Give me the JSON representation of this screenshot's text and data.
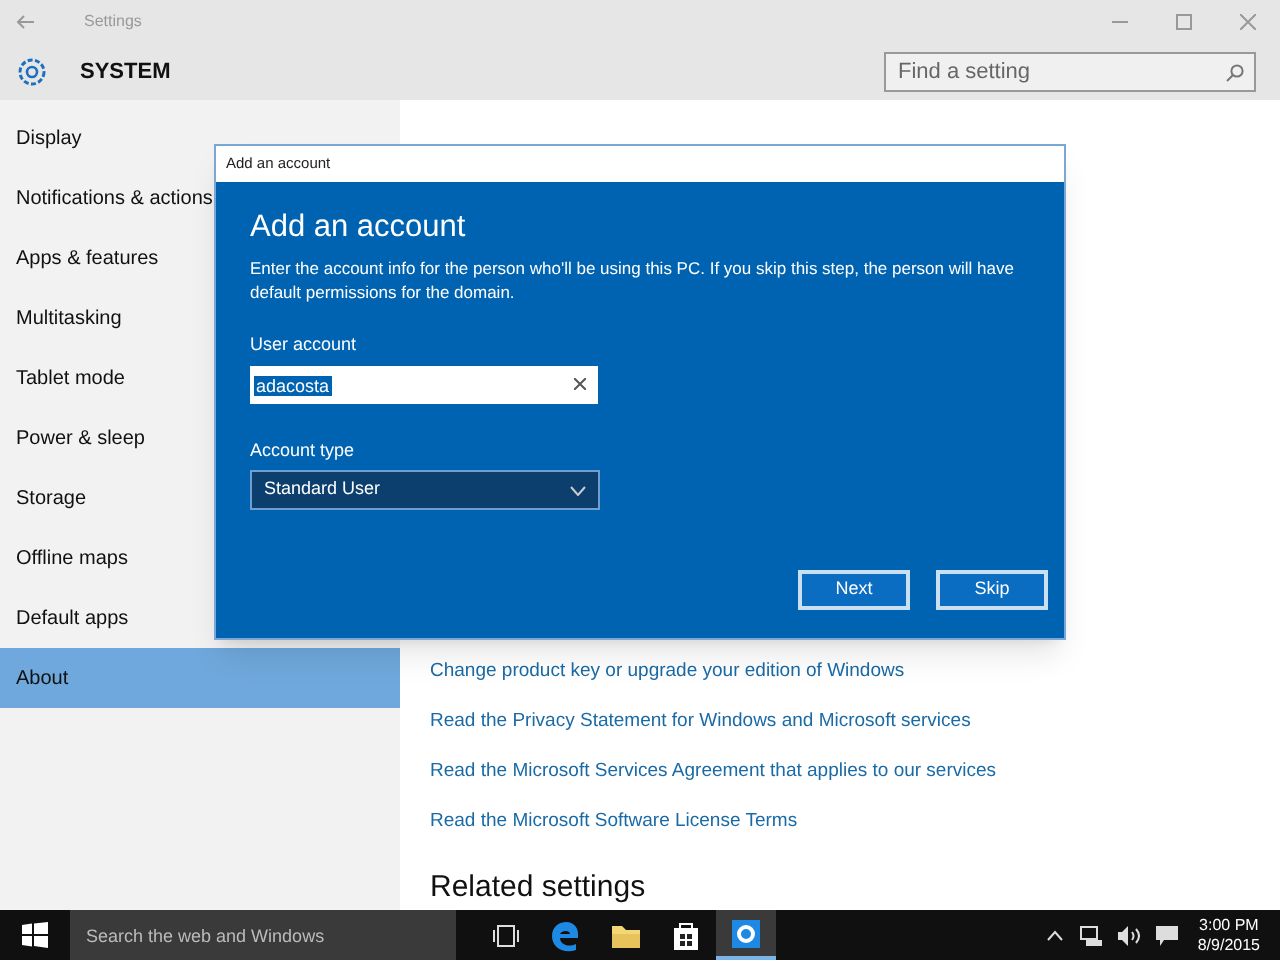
{
  "window": {
    "title": "Settings"
  },
  "header": {
    "title": "SYSTEM",
    "search": {
      "placeholder": "Find a setting"
    }
  },
  "sidebar": {
    "items": [
      {
        "label": "Display",
        "selected": false
      },
      {
        "label": "Notifications & actions",
        "selected": false
      },
      {
        "label": "Apps & features",
        "selected": false
      },
      {
        "label": "Multitasking",
        "selected": false
      },
      {
        "label": "Tablet mode",
        "selected": false
      },
      {
        "label": "Power & sleep",
        "selected": false
      },
      {
        "label": "Storage",
        "selected": false
      },
      {
        "label": "Offline maps",
        "selected": false
      },
      {
        "label": "Default apps",
        "selected": false
      },
      {
        "label": "About",
        "selected": true
      }
    ]
  },
  "content": {
    "links": [
      "Change product key or upgrade your edition of Windows",
      "Read the Privacy Statement for Windows and Microsoft services",
      "Read the Microsoft Services Agreement that applies to our services",
      "Read the Microsoft Software License Terms"
    ],
    "related_heading": "Related settings"
  },
  "dialog": {
    "title": "Add an account",
    "heading": "Add an account",
    "description": "Enter the account info for the person who'll be using this PC. If you skip this step, the person will have default permissions for the domain.",
    "user_account": {
      "label": "User account",
      "value": "adacosta"
    },
    "account_type": {
      "label": "Account type",
      "value": "Standard User"
    },
    "buttons": [
      "Next",
      "Skip"
    ]
  },
  "taskbar": {
    "search": {
      "placeholder": "Search the web and Windows"
    },
    "apps": [
      {
        "kind": "taskview",
        "active": false
      },
      {
        "kind": "edge",
        "active": false
      },
      {
        "kind": "explorer",
        "active": false
      },
      {
        "kind": "store",
        "active": false
      },
      {
        "kind": "settings",
        "active": true
      }
    ],
    "time": "3:00 PM",
    "date": "8/9/2015"
  }
}
